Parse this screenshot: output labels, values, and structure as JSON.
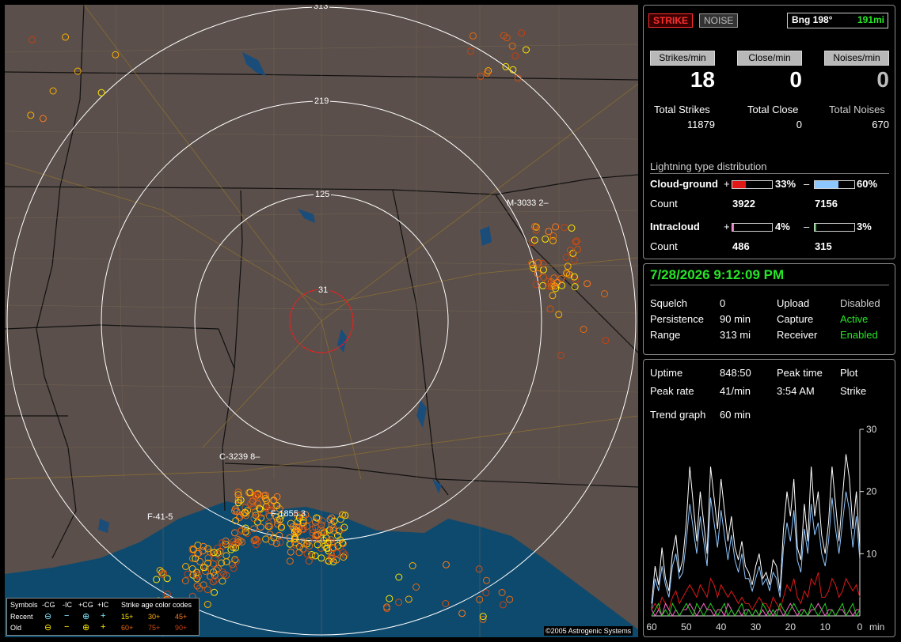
{
  "map": {
    "range_labels": [
      "313",
      "219",
      "125",
      "31"
    ],
    "site_labels": [
      "M-3033",
      "2",
      "C-3239",
      "8",
      "F-41",
      "5",
      "F-1855",
      "3"
    ],
    "copyright": "©2005 Astrogenic Systems",
    "legend": {
      "symbols_label": "Symbols",
      "cols": [
        "-CG",
        "-IC",
        "+CG",
        "+IC"
      ],
      "color_codes_label": "Strike age color codes",
      "recent_label": "Recent",
      "old_label": "Old",
      "recent_ages": [
        "15+",
        "30+",
        "45+"
      ],
      "old_ages": [
        "60+",
        "75+",
        "90+"
      ],
      "age_colors": [
        "#ffe600",
        "#ffb000",
        "#ff7a1a",
        "#e86a10",
        "#d05010",
        "#c84010"
      ]
    }
  },
  "status": {
    "strike_label": "STRIKE",
    "noise_label": "NOISE",
    "bearing": "Bng 198°",
    "distance": "191mi",
    "strikes_min_label": "Strikes/min",
    "close_min_label": "Close/min",
    "noises_min_label": "Noises/min",
    "strikes_min": "18",
    "close_min": "0",
    "noises_min": "0",
    "total_strikes_label": "Total Strikes",
    "total_close_label": "Total Close",
    "total_noises_label": "Total Noises",
    "total_strikes": "11879",
    "total_close": "0",
    "total_noises": "670"
  },
  "distribution": {
    "title": "Lightning type distribution",
    "cloud_ground_label": "Cloud-ground",
    "intracloud_label": "Intracloud",
    "count_label": "Count",
    "plus_sign": "+",
    "minus_sign": "–",
    "cg_plus_pct": "33%",
    "cg_minus_pct": "60%",
    "cg_plus_count": "3922",
    "cg_minus_count": "7156",
    "ic_plus_pct": "4%",
    "ic_minus_pct": "3%",
    "ic_plus_count": "486",
    "ic_minus_count": "315",
    "cg_plus_fill": 0.33,
    "cg_minus_fill": 0.6,
    "ic_plus_fill": 0.04,
    "ic_minus_fill": 0.03
  },
  "settings": {
    "datetime": "7/28/2026 9:12:09 PM",
    "squelch_label": "Squelch",
    "squelch": "0",
    "persistence_label": "Persistence",
    "persistence": "90 min",
    "range_label": "Range",
    "range": "313 mi",
    "upload_label": "Upload",
    "upload": "Disabled",
    "capture_label": "Capture",
    "capture": "Active",
    "receiver_label": "Receiver",
    "receiver": "Enabled"
  },
  "stats": {
    "uptime_label": "Uptime",
    "uptime": "848:50",
    "peak_time_label": "Peak time",
    "peak_time": "3:54 AM",
    "plot_label": "Plot",
    "plot": "Strike",
    "peak_rate_label": "Peak rate",
    "peak_rate": "41/min",
    "trend_label": "Trend graph",
    "trend": "60 min"
  },
  "chart_data": {
    "type": "line",
    "xlabel": "min",
    "x_ticks": [
      "60",
      "50",
      "40",
      "30",
      "20",
      "10",
      "0"
    ],
    "y_ticks": [
      "10",
      "20",
      "30"
    ],
    "xlim": [
      60,
      0
    ],
    "ylim": [
      0,
      30
    ],
    "series": [
      {
        "color": "#ffffff",
        "values": [
          2,
          8,
          5,
          11,
          6,
          4,
          10,
          13,
          7,
          9,
          15,
          24,
          18,
          12,
          20,
          15,
          10,
          24,
          19,
          14,
          22,
          17,
          12,
          16,
          11,
          9,
          12,
          8,
          7,
          5,
          8,
          10,
          6,
          7,
          5,
          9,
          8,
          4,
          14,
          20,
          16,
          22,
          11,
          9,
          18,
          12,
          24,
          16,
          20,
          13,
          10,
          15,
          24,
          18,
          12,
          19,
          26,
          22,
          14,
          20,
          11
        ]
      },
      {
        "color": "#8ec6ff",
        "values": [
          1,
          6,
          4,
          8,
          5,
          3,
          8,
          10,
          6,
          7,
          12,
          18,
          14,
          10,
          16,
          12,
          8,
          19,
          15,
          11,
          17,
          13,
          9,
          13,
          9,
          7,
          10,
          6,
          6,
          4,
          6,
          8,
          5,
          6,
          4,
          7,
          6,
          3,
          11,
          15,
          12,
          17,
          9,
          7,
          14,
          10,
          18,
          13,
          15,
          10,
          8,
          12,
          19,
          14,
          10,
          15,
          20,
          17,
          11,
          16,
          9
        ]
      },
      {
        "color": "#e01818",
        "values": [
          1,
          2,
          1,
          3,
          2,
          1,
          3,
          4,
          2,
          3,
          4,
          5,
          4,
          3,
          5,
          4,
          3,
          6,
          5,
          3,
          5,
          4,
          3,
          4,
          3,
          2,
          3,
          2,
          2,
          1,
          2,
          3,
          2,
          2,
          1,
          3,
          2,
          1,
          3,
          5,
          4,
          6,
          3,
          2,
          4,
          3,
          6,
          5,
          7,
          3,
          3,
          4,
          6,
          5,
          3,
          4,
          6,
          5,
          4,
          5,
          3
        ]
      },
      {
        "color": "#ff66cc",
        "values": [
          1,
          0,
          1,
          0,
          2,
          1,
          0,
          1,
          0,
          1,
          1,
          2,
          1,
          0,
          1,
          2,
          1,
          1,
          0,
          1,
          1,
          0,
          2,
          1,
          0,
          1,
          0,
          1,
          1,
          0,
          1,
          0,
          1,
          0,
          1,
          0,
          1,
          1,
          0,
          1,
          2,
          1,
          0,
          1,
          1,
          0,
          1,
          1,
          2,
          1,
          0,
          1,
          1,
          0,
          1,
          1,
          0,
          1,
          0,
          1,
          1
        ]
      },
      {
        "color": "#22d022",
        "values": [
          0,
          1,
          2,
          0,
          1,
          0,
          2,
          1,
          0,
          1,
          2,
          1,
          0,
          2,
          1,
          0,
          1,
          2,
          1,
          0,
          1,
          2,
          0,
          1,
          0,
          1,
          2,
          0,
          1,
          0,
          1,
          0,
          2,
          1,
          0,
          1,
          0,
          2,
          1,
          0,
          1,
          2,
          1,
          0,
          1,
          0,
          2,
          1,
          0,
          1,
          2,
          0,
          1,
          0,
          1,
          2,
          0,
          1,
          2,
          0,
          1
        ]
      }
    ]
  }
}
